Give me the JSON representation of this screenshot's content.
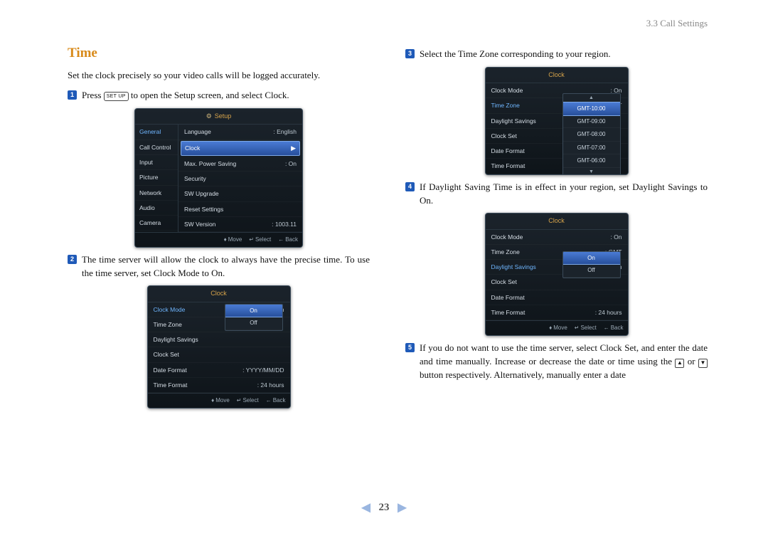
{
  "breadcrumb": "3.3 Call Settings",
  "title": "Time",
  "intro": "Set the clock precisely so your video calls will be logged accurately.",
  "setupKey": "SET UP",
  "steps": {
    "s1a": "Press ",
    "s1b": " to open the Setup screen, and select Clock.",
    "s2": "The time server will allow the clock to always have the precise time. To use the time server, set Clock Mode to On.",
    "s3": "Select the Time Zone corresponding to your region.",
    "s4": "If Daylight Saving Time is in effect in your region, set Daylight Savings to On.",
    "s5a": "If you do not want to use the time server, select ",
    "s5_clockset": "Clock Set",
    "s5b": ", and enter the date and time manually. Increase or decrease the date or time using the ",
    "s5_or": " or ",
    "s5c": " button respectively. Alternatively, manually enter a date"
  },
  "keys": {
    "up": "▲",
    "down": "▼"
  },
  "osd_footer": {
    "move": "Move",
    "select": "Select",
    "back": "Back"
  },
  "osd1": {
    "title": "Setup",
    "left": [
      "General",
      "Call Control",
      "Input",
      "Picture",
      "Network",
      "Audio",
      "Camera"
    ],
    "right": [
      {
        "label": "Language",
        "val": ": English"
      },
      {
        "label": "Clock"
      },
      {
        "label": "Max. Power Saving",
        "val": ": On"
      },
      {
        "label": "Security"
      },
      {
        "label": "SW Upgrade"
      },
      {
        "label": "Reset Settings"
      },
      {
        "label": "SW Version",
        "val": ": 1003.11"
      }
    ]
  },
  "osd2": {
    "title": "Clock",
    "rows": [
      {
        "label": "Clock Mode",
        "val": ": On",
        "sel": true
      },
      {
        "label": "Time Zone"
      },
      {
        "label": "Daylight Savings"
      },
      {
        "label": "Clock Set"
      },
      {
        "label": "Date Format",
        "val": ": YYYY/MM/DD"
      },
      {
        "label": "Time Format",
        "val": ": 24 hours"
      }
    ],
    "dropdown": [
      "On",
      "Off"
    ]
  },
  "osd3": {
    "title": "Clock",
    "rows": [
      {
        "label": "Clock Mode",
        "val": ": On"
      },
      {
        "label": "Time Zone",
        "val": ": GMT",
        "sel": true
      },
      {
        "label": "Daylight Savings"
      },
      {
        "label": "Clock Set"
      },
      {
        "label": "Date Format"
      },
      {
        "label": "Time Format"
      }
    ],
    "dropdown": [
      "GMT-10:00",
      "GMT-09:00",
      "GMT-08:00",
      "GMT-07:00",
      "GMT-06:00"
    ]
  },
  "osd4": {
    "title": "Clock",
    "rows": [
      {
        "label": "Clock Mode",
        "val": ": On"
      },
      {
        "label": "Time Zone",
        "val": ": GMT"
      },
      {
        "label": "Daylight Savings",
        "val": ": On",
        "sel": true
      },
      {
        "label": "Clock Set"
      },
      {
        "label": "Date Format"
      },
      {
        "label": "Time Format",
        "val": ": 24 hours"
      }
    ],
    "dropdown": [
      "On",
      "Off"
    ]
  },
  "pager": {
    "num": "23"
  }
}
